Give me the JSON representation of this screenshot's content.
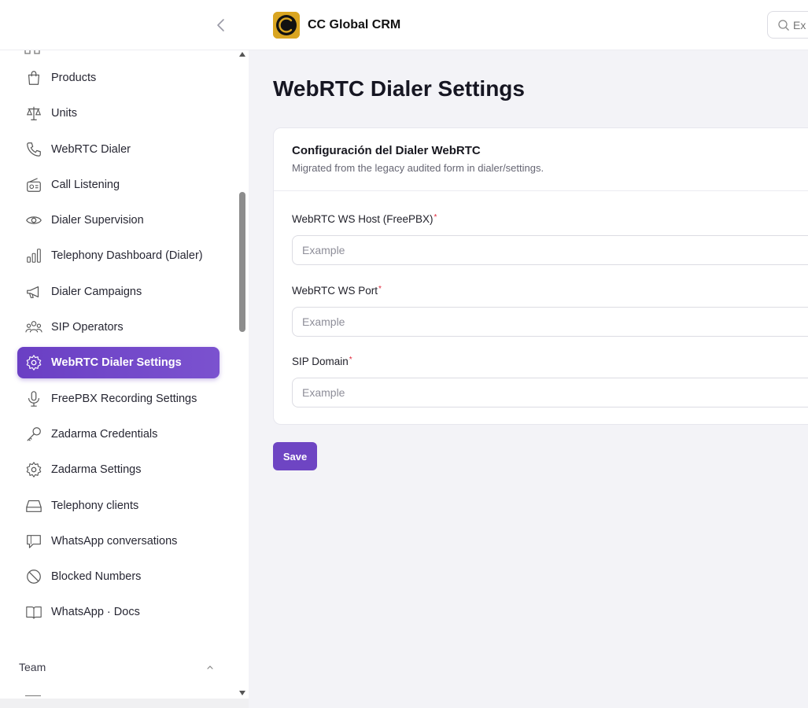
{
  "app": {
    "name": "CC Global CRM"
  },
  "search": {
    "placeholder": "Ex"
  },
  "sidebar": {
    "items": [
      {
        "label": "Products",
        "icon": "shopping-bag-icon",
        "active": false
      },
      {
        "label": "Units",
        "icon": "scale-icon",
        "active": false
      },
      {
        "label": "WebRTC Dialer",
        "icon": "phone-icon",
        "active": false
      },
      {
        "label": "Call Listening",
        "icon": "radio-icon",
        "active": false
      },
      {
        "label": "Dialer Supervision",
        "icon": "eye-icon",
        "active": false
      },
      {
        "label": "Telephony Dashboard (Dialer)",
        "icon": "bar-chart-icon",
        "active": false
      },
      {
        "label": "Dialer Campaigns",
        "icon": "megaphone-icon",
        "active": false
      },
      {
        "label": "SIP Operators",
        "icon": "users-icon",
        "active": false
      },
      {
        "label": "WebRTC Dialer Settings",
        "icon": "gear-icon",
        "active": true
      },
      {
        "label": "FreePBX Recording Settings",
        "icon": "microphone-icon",
        "active": false
      },
      {
        "label": "Zadarma Credentials",
        "icon": "key-icon",
        "active": false
      },
      {
        "label": "Zadarma Settings",
        "icon": "gear-icon",
        "active": false
      },
      {
        "label": "Telephony clients",
        "icon": "inbox-icon",
        "active": false
      },
      {
        "label": "WhatsApp conversations",
        "icon": "chat-icon",
        "active": false
      },
      {
        "label": "Blocked Numbers",
        "icon": "blocked-icon",
        "active": false
      },
      {
        "label": "WhatsApp · Docs",
        "icon": "book-icon",
        "active": false
      }
    ],
    "team_label": "Team"
  },
  "main": {
    "title": "WebRTC Dialer Settings",
    "card": {
      "title": "Configuración del Dialer WebRTC",
      "subtitle": "Migrated from the legacy audited form in dialer/settings.",
      "fields": [
        {
          "label": "WebRTC WS Host (FreePBX)",
          "required_mark": "*",
          "placeholder": "Example",
          "value": ""
        },
        {
          "label": "WebRTC WS Port",
          "required_mark": "*",
          "placeholder": "Example",
          "value": ""
        },
        {
          "label": "SIP Domain",
          "required_mark": "*",
          "placeholder": "Example",
          "value": ""
        }
      ]
    },
    "save_label": "Save"
  },
  "colors": {
    "accent": "#6e45c3",
    "active_bg": "#6a3fc4",
    "required": "#e0263a",
    "logo_gold": "#d9a521"
  }
}
